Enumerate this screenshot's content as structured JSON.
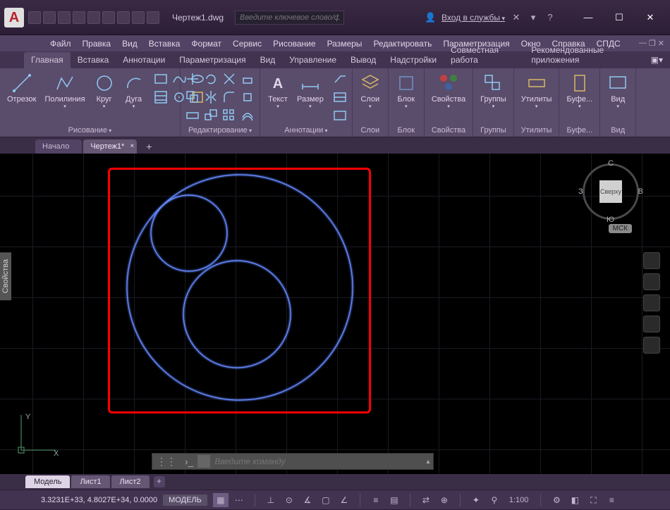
{
  "title": {
    "document": "Чертеж1.dwg",
    "search_placeholder": "Введите ключевое слово/фразу",
    "login": "Вход в службы"
  },
  "menubar": [
    "Файл",
    "Правка",
    "Вид",
    "Вставка",
    "Формат",
    "Сервис",
    "Рисование",
    "Размеры",
    "Редактировать",
    "Параметризация",
    "Окно",
    "Справка",
    "СПДС"
  ],
  "ribbon_tabs": [
    "Главная",
    "Вставка",
    "Аннотации",
    "Параметризация",
    "Вид",
    "Управление",
    "Вывод",
    "Надстройки",
    "Совместная работа",
    "Рекомендованные приложения"
  ],
  "ribbon": {
    "draw": {
      "label": "Рисование",
      "line": "Отрезок",
      "polyline": "Полилиния",
      "circle": "Круг",
      "arc": "Дуга"
    },
    "modify": {
      "label": "Редактирование"
    },
    "annotation": {
      "label": "Аннотации",
      "text": "Текст",
      "dimension": "Размер"
    },
    "layers": {
      "label": "Слои",
      "btn": "Слои"
    },
    "block": {
      "label": "Блок",
      "btn": "Блок"
    },
    "properties": {
      "label": "Свойства",
      "btn": "Свойства"
    },
    "groups": {
      "label": "Группы",
      "btn": "Группы"
    },
    "utilities": {
      "label": "Утилиты",
      "btn": "Утилиты"
    },
    "clipboard": {
      "label": "Буфе...",
      "btn": "Буфе..."
    },
    "view": {
      "label": "Вид",
      "btn": "Вид"
    }
  },
  "doc_tabs": {
    "start": "Начало",
    "current": "Чертеж1*"
  },
  "viewcube": {
    "top": "Сверху",
    "n": "С",
    "s": "Ю",
    "e": "В",
    "w": "З",
    "wcs": "МСК"
  },
  "side_panel": "Свойства",
  "command": {
    "placeholder": "Введите команду"
  },
  "layout_tabs": [
    "Модель",
    "Лист1",
    "Лист2"
  ],
  "statusbar": {
    "coords": "3.3231E+33, 4.8027E+34, 0.0000",
    "space": "МОДЕЛЬ",
    "scale": "1:100"
  },
  "ucs": {
    "x": "X",
    "y": "Y"
  }
}
